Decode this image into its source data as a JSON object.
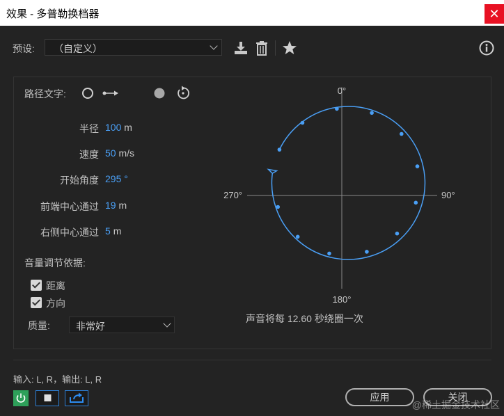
{
  "window": {
    "title": "效果 - 多普勒换档器",
    "close_glyph": "✕"
  },
  "toolbar": {
    "preset_label": "预设:",
    "preset_value": "（自定义）"
  },
  "path_text": {
    "label": "路径文字:"
  },
  "params": [
    {
      "label": "半径",
      "value": "100",
      "unit": "m"
    },
    {
      "label": "速度",
      "value": "50",
      "unit": "m/s"
    },
    {
      "label": "开始角度",
      "value": "295",
      "unit": "°"
    },
    {
      "label": "前端中心通过",
      "value": "19",
      "unit": "m"
    },
    {
      "label": "右侧中心通过",
      "value": "5",
      "unit": "m"
    }
  ],
  "volume": {
    "label": "音量调节依据:",
    "checkboxes": [
      {
        "label": "距离",
        "checked": true
      },
      {
        "label": "方向",
        "checked": true
      }
    ]
  },
  "quality": {
    "label": "质量:",
    "value": "非常好"
  },
  "diagram": {
    "labels": {
      "top": "0°",
      "right": "90°",
      "bottom": "180°",
      "left": "270°"
    },
    "caption": "声音将每 12.60 秒绕圈一次",
    "accent": "#4a9ff5"
  },
  "footer": {
    "io": "输入: L, R，输出: L, R",
    "apply": "应用",
    "close": "关闭",
    "watermark": "@稀土掘金技术社区"
  }
}
